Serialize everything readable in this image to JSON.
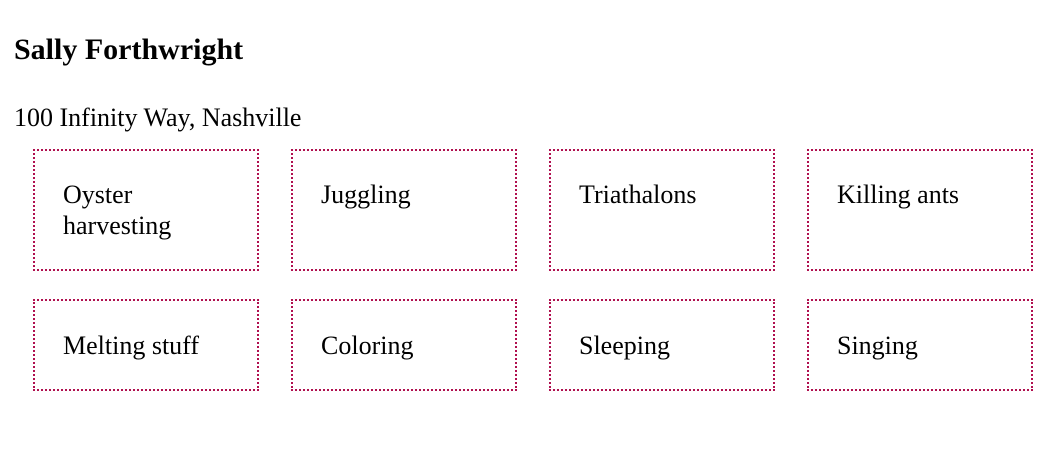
{
  "profile": {
    "name": "Sally Forthwright",
    "address": "100 Infinity Way, Nashville"
  },
  "hobbies": [
    "Oyster harvesting",
    "Juggling",
    "Triathalons",
    "Killing ants",
    "Melting stuff",
    "Coloring",
    "Sleeping",
    "Singing"
  ],
  "colors": {
    "card_border": "#b0104f"
  }
}
